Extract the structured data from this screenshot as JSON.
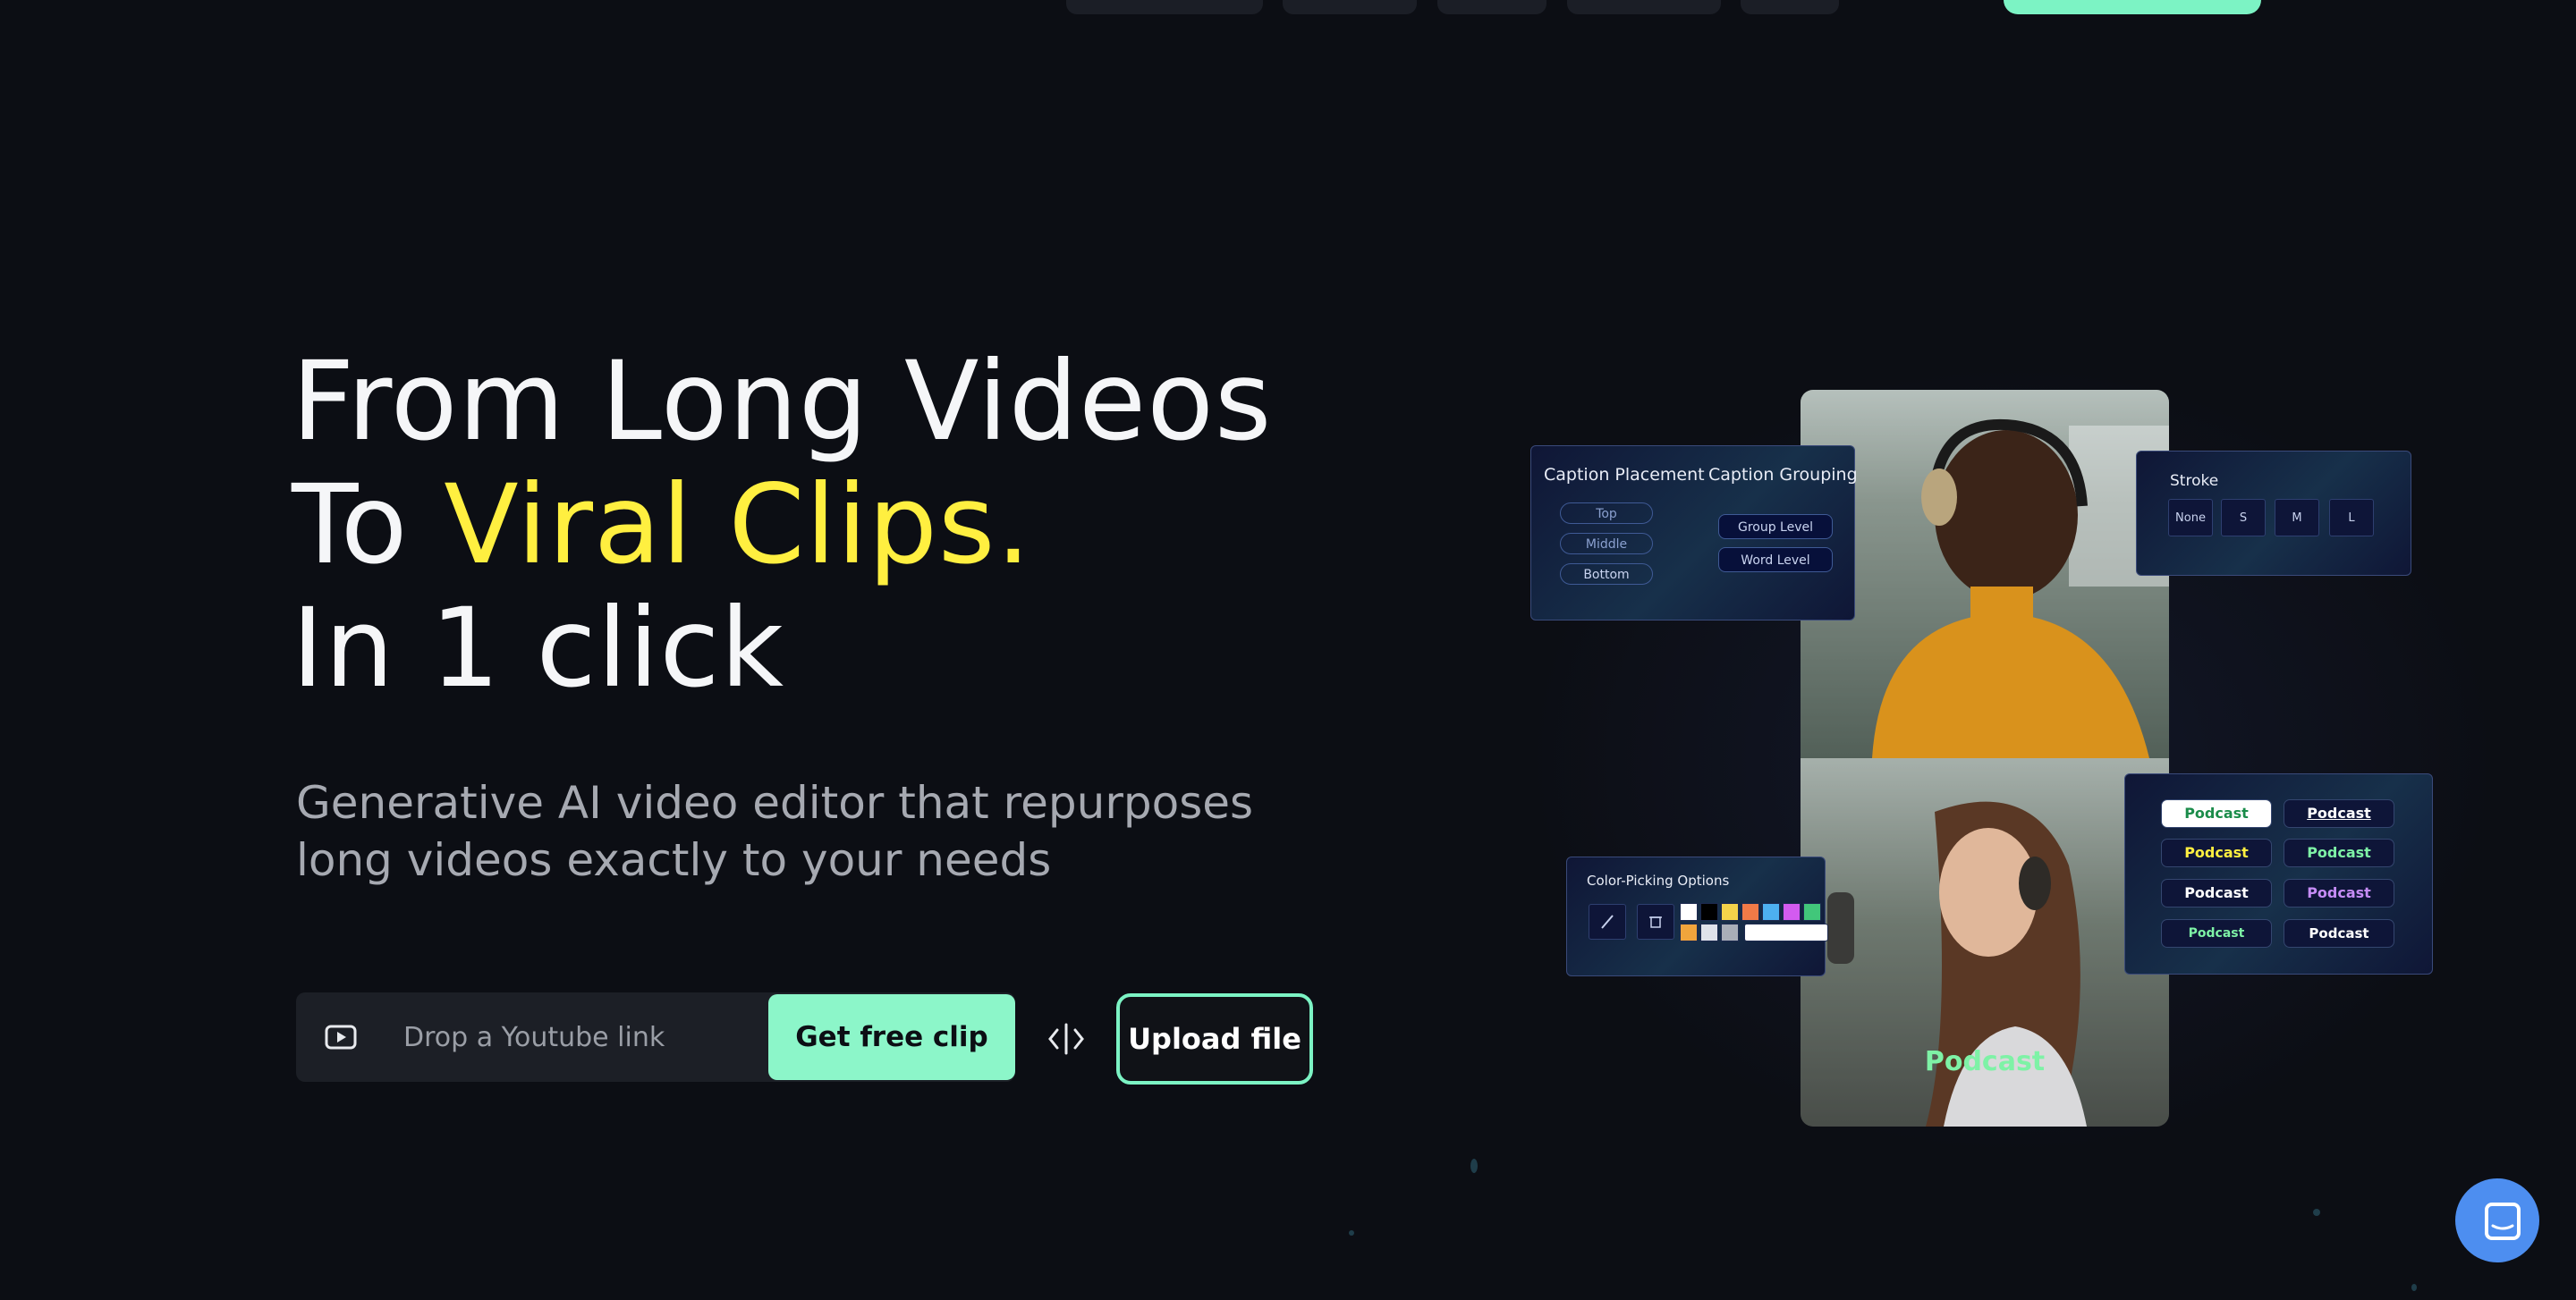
{
  "hero": {
    "line1": "From Long Videos",
    "line2_prefix": "To ",
    "line2_accent": "Viral Clips.",
    "line3": "In 1 click",
    "subtitle": "Generative AI video editor that repurposes long videos exactly to your needs",
    "accent_color": "#ffef40"
  },
  "input": {
    "placeholder": "Drop a Youtube link",
    "cta_label": "Get free clip",
    "upload_label": "Upload file"
  },
  "showcase": {
    "caption_placement": {
      "title": "Caption Placement",
      "options": [
        "Top",
        "Middle",
        "Bottom"
      ]
    },
    "caption_grouping": {
      "title": "Caption Grouping",
      "options": [
        "Group Level",
        "Word Level"
      ]
    },
    "stroke": {
      "title": "Stroke",
      "options": [
        "None",
        "S",
        "M",
        "L"
      ]
    },
    "color_picking": {
      "title": "Color-Picking Options",
      "swatches": [
        "#ffffff",
        "#000000",
        "#f4d34a",
        "#f07a47",
        "#4db0f0",
        "#d35bf0",
        "#41c77a",
        "#f0a53c",
        "#dfe3ea",
        "#a9aeb8"
      ]
    },
    "caption_styles": [
      "Podcast",
      "Podcast",
      "Podcast",
      "Podcast",
      "Podcast",
      "Podcast",
      "Podcast",
      "Podcast"
    ],
    "video_caption": "Podcast"
  },
  "colors": {
    "background": "#0c0e14",
    "mint": "#8cf6c9",
    "chat": "#4d8ef0"
  }
}
